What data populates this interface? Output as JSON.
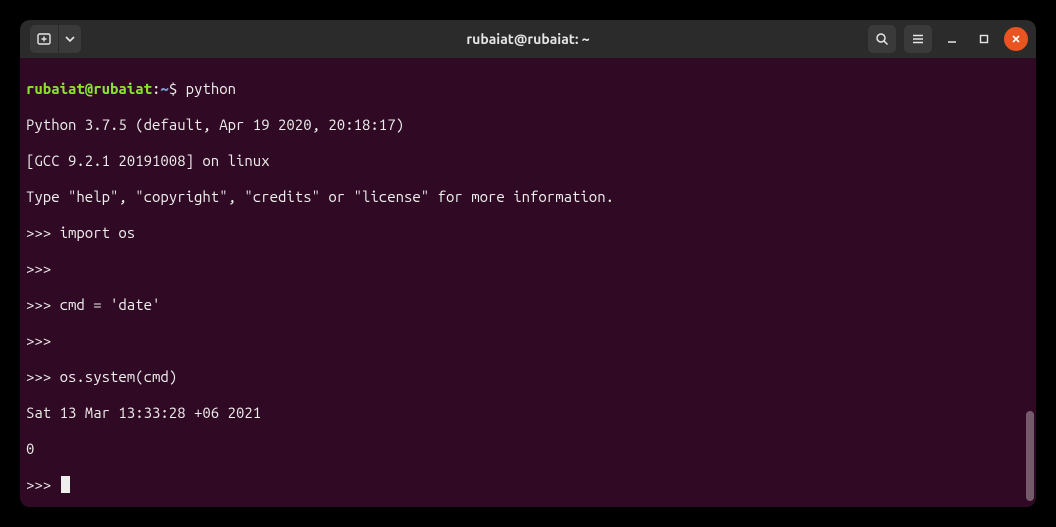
{
  "window": {
    "title": "rubaiat@rubaiat: ~"
  },
  "prompt": {
    "userhost": "rubaiat@rubaiat",
    "colon": ":",
    "path": "~",
    "symbol": "$"
  },
  "icons": {
    "new_tab": "new-tab-icon",
    "dropdown": "chevron-down-icon",
    "search": "search-icon",
    "menu": "hamburger-icon",
    "minimize": "minimize-icon",
    "maximize": "maximize-icon",
    "close": "close-icon"
  },
  "session": {
    "shell_cmd": "python",
    "lines": [
      "Python 3.7.5 (default, Apr 19 2020, 20:18:17)",
      "[GCC 9.2.1 20191008] on linux",
      "Type \"help\", \"copyright\", \"credits\" or \"license\" for more information.",
      ">>> import os",
      ">>>",
      ">>> cmd = 'date'",
      ">>>",
      ">>> os.system(cmd)",
      "Sat 13 Mar 13:33:28 +06 2021",
      "0",
      ">>> "
    ]
  }
}
